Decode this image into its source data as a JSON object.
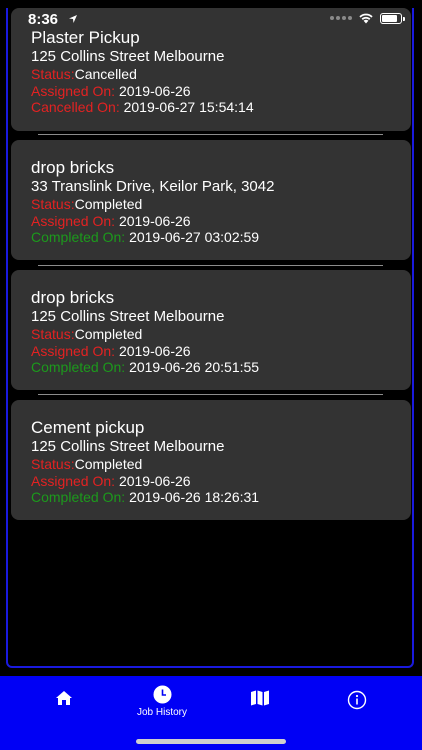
{
  "status_bar": {
    "time": "8:36"
  },
  "jobs": [
    {
      "title": "Plaster Pickup",
      "address": "125 Collins Street Melbourne",
      "status_label": "Status:",
      "status_value": "Cancelled",
      "assigned_label": "Assigned On:",
      "assigned_value": "2019-06-26",
      "end_label": "Cancelled On:",
      "end_value": "2019-06-27 15:54:14"
    },
    {
      "title": "drop bricks",
      "address": "33 Translink Drive, Keilor Park, 3042",
      "status_label": "Status:",
      "status_value": "Completed",
      "assigned_label": "Assigned On:",
      "assigned_value": "2019-06-26",
      "end_label": "Completed On:",
      "end_value": "2019-06-27 03:02:59"
    },
    {
      "title": "drop bricks",
      "address": "125 Collins Street Melbourne",
      "status_label": "Status:",
      "status_value": "Completed",
      "assigned_label": "Assigned On:",
      "assigned_value": "2019-06-26",
      "end_label": "Completed On:",
      "end_value": "2019-06-26 20:51:55"
    },
    {
      "title": "Cement pickup",
      "address": "125 Collins Street Melbourne",
      "status_label": "Status:",
      "status_value": "Completed",
      "assigned_label": "Assigned On:",
      "assigned_value": "2019-06-26",
      "end_label": "Completed On:",
      "end_value": "2019-06-26 18:26:31"
    }
  ],
  "tabbar": {
    "tabs": [
      {
        "icon": "home-icon",
        "label": ""
      },
      {
        "icon": "clock-icon",
        "label": "Job History"
      },
      {
        "icon": "map-icon",
        "label": ""
      },
      {
        "icon": "info-icon",
        "label": ""
      }
    ]
  },
  "colors": {
    "accent": "#0000f5",
    "label_red": "#e32222",
    "label_green": "#1c9a1c",
    "card": "#333333"
  }
}
